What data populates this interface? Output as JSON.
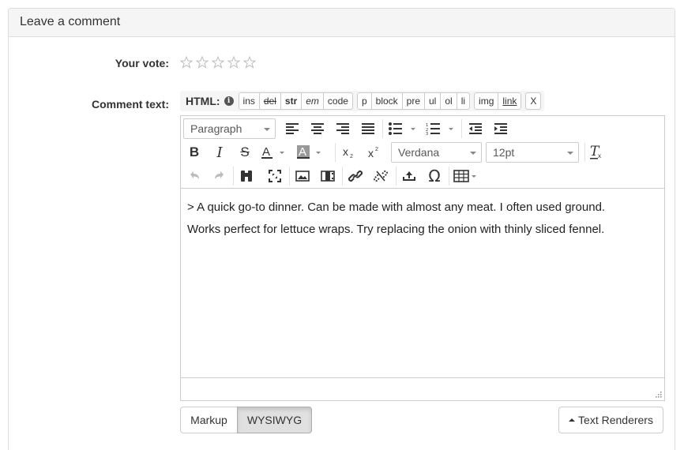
{
  "panel": {
    "title": "Leave a comment"
  },
  "vote": {
    "label": "Your vote:",
    "stars": 5,
    "rating": 0
  },
  "comment": {
    "label": "Comment text:"
  },
  "html_bar": {
    "label": "HTML:",
    "group1": [
      "ins",
      "del",
      "str",
      "em",
      "code"
    ],
    "group2": [
      "p",
      "block",
      "pre",
      "ul",
      "ol",
      "li"
    ],
    "group3": [
      "img",
      "link"
    ],
    "group4": [
      "X"
    ]
  },
  "toolbar": {
    "block_format": "Paragraph",
    "font_family": "Verdana",
    "font_size": "12pt"
  },
  "editor": {
    "line1": "> A quick go-to dinner. Can be made with almost any meat. I often used ground.",
    "line2": "Works perfect for lettuce wraps. Try replacing the onion with thinly sliced fennel."
  },
  "buttons": {
    "markup": "Markup",
    "wysiwyg": "WYSIWYG",
    "renderers": "Text Renderers"
  }
}
